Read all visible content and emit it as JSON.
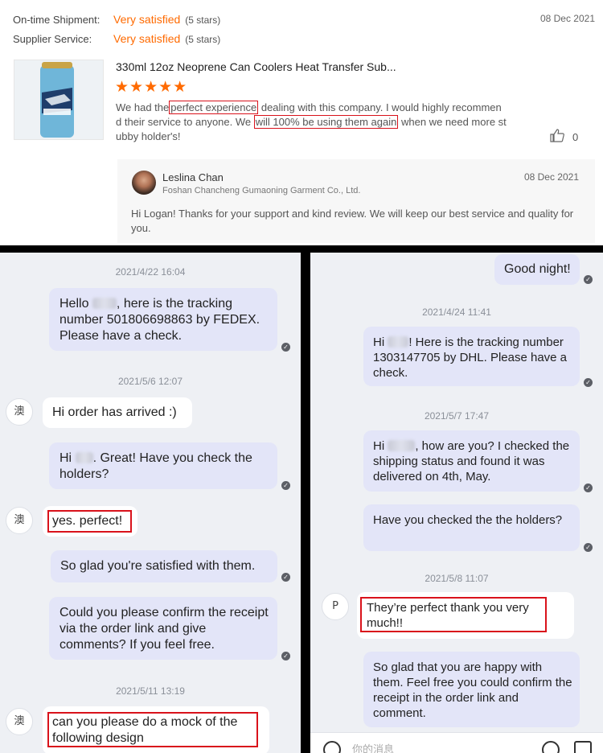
{
  "review": {
    "shipment_label": "On-time Shipment:",
    "shipment_value": "Very satisfied",
    "shipment_stars": "(5 stars)",
    "service_label": "Supplier Service:",
    "service_value": "Very satisfied",
    "service_stars": "(5 stars)",
    "date": "08 Dec 2021",
    "product_title": "330ml 12oz Neoprene Can Coolers Heat Transfer Sub...",
    "stars": "★★★★★",
    "text_1": "We had the",
    "highlight_1": "perfect experience",
    "text_2": "dealing with this company. I would highly recommend their service to anyone. We",
    "highlight_2": "will 100% be using them again",
    "text_3": "when we need more stubby holder's!",
    "likes": "0",
    "reply": {
      "name": "Leslina Chan",
      "company": "Foshan Chancheng Gumaoning Garment Co., Ltd.",
      "date": "08 Dec 2021",
      "text": "Hi Logan! Thanks for your support and kind review. We will keep our best service and quality for you."
    }
  },
  "left_chat": {
    "ts1": "2021/4/22 16:04",
    "m1_a": "Hello",
    "m1_b": ", here is the tracking number 501806698863 by FEDEX. Please have a check.",
    "ts2": "2021/5/6 12:07",
    "buyer_avatar": "澳",
    "m2": "Hi order has arrived :)",
    "m3_a": "Hi",
    "m3_b": ". Great! Have you check the holders?",
    "m4": "yes. perfect!",
    "m5": "So glad you're satisfied with them.",
    "m6": "Could you please confirm the receipt via the order link and give comments? If you feel free.",
    "ts3": "2021/5/11 13:19",
    "m7": "can you please do a mock of the following design"
  },
  "right_chat": {
    "m0": "Good night!",
    "ts1": "2021/4/24 11:41",
    "m1_a": "Hi",
    "m1_b": "! Here is the tracking number 1303147705 by DHL. Please have a check.",
    "ts2": "2021/5/7 17:47",
    "m2_a": "Hi",
    "m2_b": ", how are you?  I checked the shipping status and found it was delivered on 4th, May.",
    "m3": "Have you checked the the holders?",
    "ts3": "2021/5/8 11:07",
    "buyer_avatar": "P",
    "m4": "They’re perfect thank you very much!!",
    "m5": "So glad that you are happy with them. Feel free you could confirm the receipt in the order link and comment.",
    "input_placeholder": "你的消息"
  }
}
